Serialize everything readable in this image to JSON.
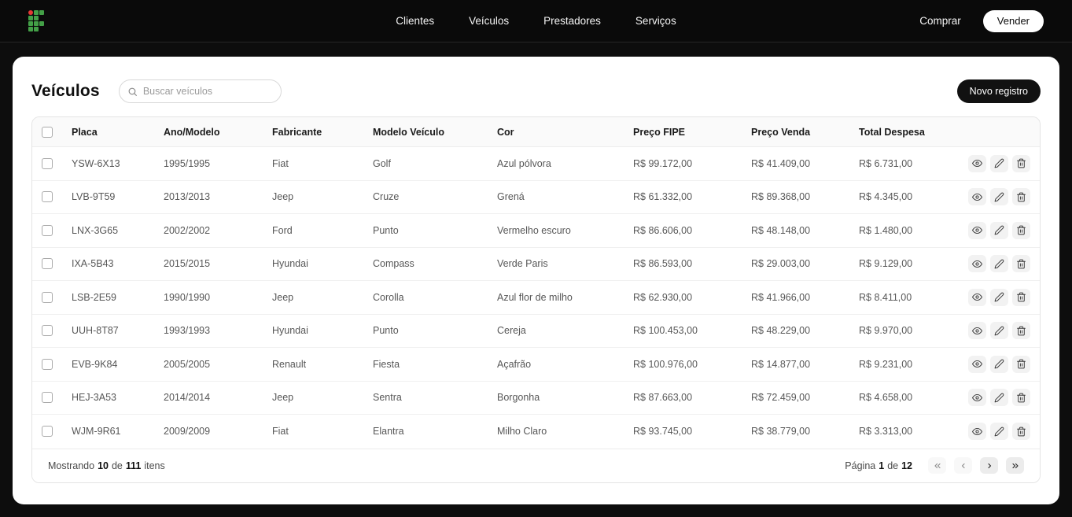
{
  "navbar": {
    "links": [
      {
        "label": "Clientes"
      },
      {
        "label": "Veículos"
      },
      {
        "label": "Prestadores"
      },
      {
        "label": "Serviços"
      }
    ],
    "comprar_label": "Comprar",
    "vender_label": "Vender"
  },
  "page": {
    "title": "Veículos",
    "search_placeholder": "Buscar veículos",
    "new_record_label": "Novo registro"
  },
  "table": {
    "columns": [
      "Placa",
      "Ano/Modelo",
      "Fabricante",
      "Modelo Veículo",
      "Cor",
      "Preço FIPE",
      "Preço Venda",
      "Total Despesa"
    ],
    "rows": [
      {
        "placa": "YSW-6X13",
        "ano": "1995/1995",
        "fabricante": "Fiat",
        "modelo": "Golf",
        "cor": "Azul pólvora",
        "fipe": "R$ 99.172,00",
        "venda": "R$ 41.409,00",
        "despesa": "R$ 6.731,00"
      },
      {
        "placa": "LVB-9T59",
        "ano": "2013/2013",
        "fabricante": "Jeep",
        "modelo": "Cruze",
        "cor": "Grená",
        "fipe": "R$ 61.332,00",
        "venda": "R$ 89.368,00",
        "despesa": "R$ 4.345,00"
      },
      {
        "placa": "LNX-3G65",
        "ano": "2002/2002",
        "fabricante": "Ford",
        "modelo": "Punto",
        "cor": "Vermelho escuro",
        "fipe": "R$ 86.606,00",
        "venda": "R$ 48.148,00",
        "despesa": "R$ 1.480,00"
      },
      {
        "placa": "IXA-5B43",
        "ano": "2015/2015",
        "fabricante": "Hyundai",
        "modelo": "Compass",
        "cor": "Verde Paris",
        "fipe": "R$ 86.593,00",
        "venda": "R$ 29.003,00",
        "despesa": "R$ 9.129,00"
      },
      {
        "placa": "LSB-2E59",
        "ano": "1990/1990",
        "fabricante": "Jeep",
        "modelo": "Corolla",
        "cor": "Azul flor de milho",
        "fipe": "R$ 62.930,00",
        "venda": "R$ 41.966,00",
        "despesa": "R$ 8.411,00"
      },
      {
        "placa": "UUH-8T87",
        "ano": "1993/1993",
        "fabricante": "Hyundai",
        "modelo": "Punto",
        "cor": "Cereja",
        "fipe": "R$ 100.453,00",
        "venda": "R$ 48.229,00",
        "despesa": "R$ 9.970,00"
      },
      {
        "placa": "EVB-9K84",
        "ano": "2005/2005",
        "fabricante": "Renault",
        "modelo": "Fiesta",
        "cor": "Açafrão",
        "fipe": "R$ 100.976,00",
        "venda": "R$ 14.877,00",
        "despesa": "R$ 9.231,00"
      },
      {
        "placa": "HEJ-3A53",
        "ano": "2014/2014",
        "fabricante": "Jeep",
        "modelo": "Sentra",
        "cor": "Borgonha",
        "fipe": "R$ 87.663,00",
        "venda": "R$ 72.459,00",
        "despesa": "R$ 4.658,00"
      },
      {
        "placa": "WJM-9R61",
        "ano": "2009/2009",
        "fabricante": "Fiat",
        "modelo": "Elantra",
        "cor": "Milho Claro",
        "fipe": "R$ 93.745,00",
        "venda": "R$ 38.779,00",
        "despesa": "R$ 3.313,00"
      }
    ]
  },
  "footer": {
    "showing": [
      "Mostrando",
      "10",
      "de",
      "111",
      "itens"
    ],
    "paging": [
      "Página",
      "1",
      "de",
      "12"
    ]
  },
  "icons": {
    "logo": "pixel-grid-if-logo",
    "search": "search-icon",
    "view": "eye-icon",
    "edit": "pencil-icon",
    "delete": "trash-icon",
    "first": "double-chevron-left-icon",
    "prev": "chevron-left-icon",
    "next": "chevron-right-icon",
    "last": "double-chevron-right-icon"
  },
  "colors": {
    "navbar_bg": "#0a0a0a",
    "page_bg": "#0d0d0d",
    "card_bg": "#ffffff",
    "logo_green": "#43a047",
    "logo_red": "#e53935",
    "primary_button_bg": "#111111"
  }
}
